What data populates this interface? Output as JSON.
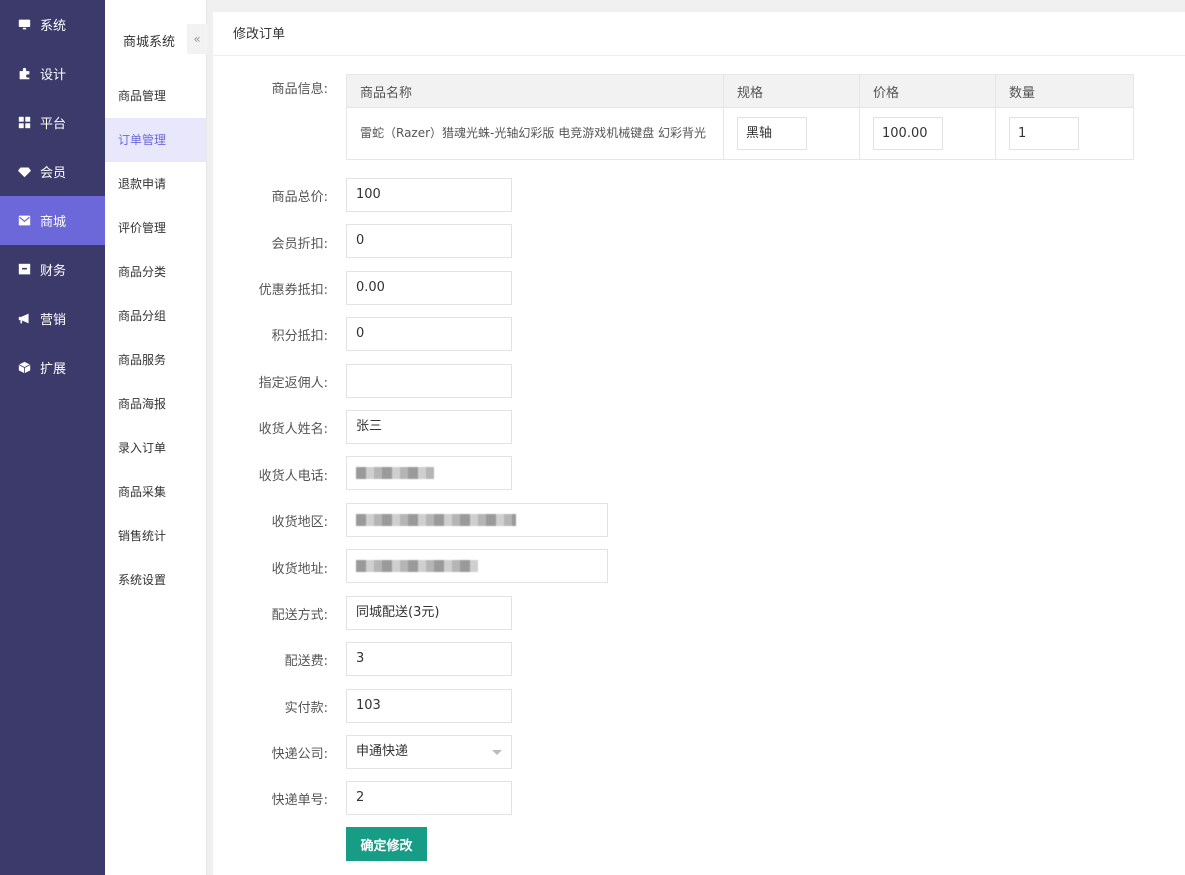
{
  "nav": [
    {
      "label": "系统",
      "icon": "monitor-icon"
    },
    {
      "label": "设计",
      "icon": "puzzle-icon"
    },
    {
      "label": "平台",
      "icon": "grid-icon"
    },
    {
      "label": "会员",
      "icon": "diamond-icon"
    },
    {
      "label": "商城",
      "icon": "mail-icon",
      "active": true
    },
    {
      "label": "财务",
      "icon": "wallet-icon"
    },
    {
      "label": "营销",
      "icon": "megaphone-icon"
    },
    {
      "label": "扩展",
      "icon": "cube-icon"
    }
  ],
  "submenu": {
    "title": "商城系统",
    "collapse": "«",
    "items": [
      "商品管理",
      "订单管理",
      "退款申请",
      "评价管理",
      "商品分类",
      "商品分组",
      "商品服务",
      "商品海报",
      "录入订单",
      "商品采集",
      "销售统计",
      "系统设置"
    ]
  },
  "page": {
    "title": "修改订单"
  },
  "product": {
    "label": "商品信息:",
    "headers": [
      "商品名称",
      "规格",
      "价格",
      "数量"
    ],
    "name": "雷蛇（Razer）猎魂光蛛-光轴幻彩版 电竞游戏机械键盘 幻彩背光",
    "spec": "黑轴",
    "price": "100.00",
    "qty": "1"
  },
  "form": {
    "total_label": "商品总价:",
    "total": "100",
    "member_discount_label": "会员折扣:",
    "member_discount": "0",
    "coupon_label": "优惠券抵扣:",
    "coupon": "0.00",
    "points_label": "积分抵扣:",
    "points": "0",
    "referrer_label": "指定返佣人:",
    "referrer": "",
    "receiver_name_label": "收货人姓名:",
    "receiver_name": "张三",
    "receiver_phone_label": "收货人电话:",
    "region_label": "收货地区:",
    "address_label": "收货地址:",
    "delivery_method_label": "配送方式:",
    "delivery_method": "同城配送(3元)",
    "delivery_fee_label": "配送费:",
    "delivery_fee": "3",
    "paid_label": "实付款:",
    "paid": "103",
    "courier_label": "快递公司:",
    "courier": "申通快递",
    "tracking_label": "快递单号:",
    "tracking": "2"
  },
  "submit_label": "确定修改"
}
